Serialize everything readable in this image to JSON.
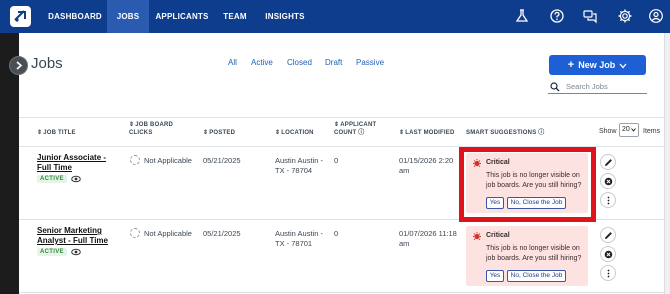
{
  "nav": {
    "items": [
      {
        "label": "DASHBOARD",
        "active": false
      },
      {
        "label": "JOBS",
        "active": true
      },
      {
        "label": "APPLICANTS",
        "active": false
      },
      {
        "label": "TEAM",
        "active": false
      },
      {
        "label": "INSIGHTS",
        "active": false
      }
    ],
    "right_icons": [
      "flask-icon",
      "help-icon",
      "chat-icon",
      "gear-icon",
      "user-icon"
    ]
  },
  "page": {
    "title": "Jobs",
    "filters": [
      "All",
      "Active",
      "Closed",
      "Draft",
      "Passive"
    ],
    "new_job_label": "New Job",
    "search_placeholder": "Search Jobs"
  },
  "table": {
    "headers": {
      "job_title": "JOB TITLE",
      "job_board_clicks": "JOB BOARD CLICKS",
      "posted": "POSTED",
      "location": "LOCATION",
      "applicant_count": "APPLICANT COUNT",
      "last_modified": "LAST MODIFIED",
      "smart_suggestions": "SMART SUGGESTIONS"
    },
    "show_label": "Show",
    "show_value": "20",
    "items_label": "Items",
    "rows": [
      {
        "title": "Junior Associate - Full Time",
        "status": "ACTIVE",
        "clicks": "Not Applicable",
        "posted": "05/21/2025",
        "location": "Austin Austin - TX - 78704",
        "applicants": "0",
        "modified": "01/15/2026 2:20 am",
        "suggestion": {
          "title": "Critical",
          "message": "This job is no longer visible on job boards. Are you still hiring?",
          "yes_label": "Yes",
          "no_label": "No, Close the Job"
        }
      },
      {
        "title": "Senior Marketing Analyst - Full Time",
        "status": "ACTIVE",
        "clicks": "Not Applicable",
        "posted": "05/21/2025",
        "location": "Austin Austin - TX - 78701",
        "applicants": "0",
        "modified": "01/07/2026 11:18 am",
        "suggestion": {
          "title": "Critical",
          "message": "This job is no longer visible on job boards. Are you still hiring?",
          "yes_label": "Yes",
          "no_label": "No, Close the Job"
        }
      }
    ]
  },
  "colors": {
    "nav_bg": "#0d3d8c",
    "nav_active": "#2a5bb0",
    "primary": "#1f5fd6",
    "critical_bg": "#fde2e2",
    "highlight": "#e0121b",
    "active_badge": "#2e8b3a"
  }
}
